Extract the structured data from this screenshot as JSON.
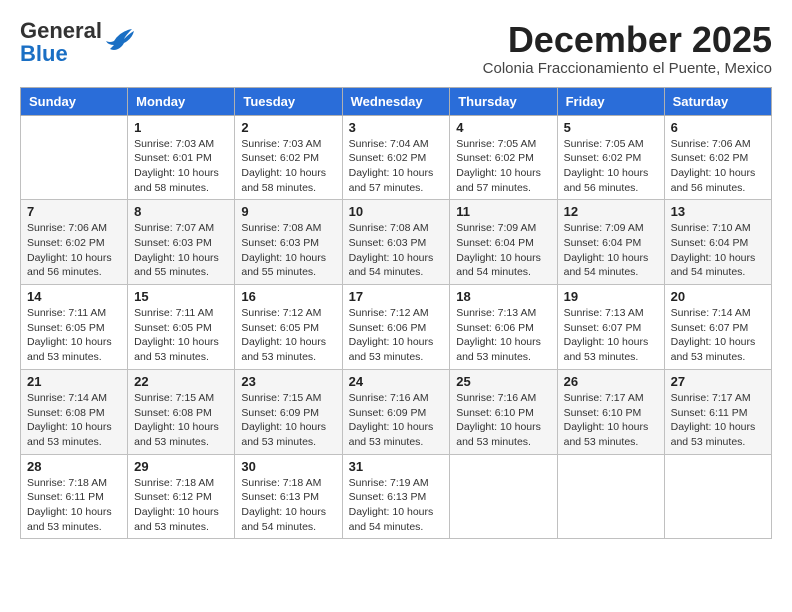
{
  "header": {
    "logo_general": "General",
    "logo_blue": "Blue",
    "month_title": "December 2025",
    "subtitle": "Colonia Fraccionamiento el Puente, Mexico"
  },
  "days_of_week": [
    "Sunday",
    "Monday",
    "Tuesday",
    "Wednesday",
    "Thursday",
    "Friday",
    "Saturday"
  ],
  "weeks": [
    [
      {
        "day": "",
        "info": ""
      },
      {
        "day": "1",
        "info": "Sunrise: 7:03 AM\nSunset: 6:01 PM\nDaylight: 10 hours and 58 minutes."
      },
      {
        "day": "2",
        "info": "Sunrise: 7:03 AM\nSunset: 6:02 PM\nDaylight: 10 hours and 58 minutes."
      },
      {
        "day": "3",
        "info": "Sunrise: 7:04 AM\nSunset: 6:02 PM\nDaylight: 10 hours and 57 minutes."
      },
      {
        "day": "4",
        "info": "Sunrise: 7:05 AM\nSunset: 6:02 PM\nDaylight: 10 hours and 57 minutes."
      },
      {
        "day": "5",
        "info": "Sunrise: 7:05 AM\nSunset: 6:02 PM\nDaylight: 10 hours and 56 minutes."
      },
      {
        "day": "6",
        "info": "Sunrise: 7:06 AM\nSunset: 6:02 PM\nDaylight: 10 hours and 56 minutes."
      }
    ],
    [
      {
        "day": "7",
        "info": "Sunrise: 7:06 AM\nSunset: 6:02 PM\nDaylight: 10 hours and 56 minutes."
      },
      {
        "day": "8",
        "info": "Sunrise: 7:07 AM\nSunset: 6:03 PM\nDaylight: 10 hours and 55 minutes."
      },
      {
        "day": "9",
        "info": "Sunrise: 7:08 AM\nSunset: 6:03 PM\nDaylight: 10 hours and 55 minutes."
      },
      {
        "day": "10",
        "info": "Sunrise: 7:08 AM\nSunset: 6:03 PM\nDaylight: 10 hours and 54 minutes."
      },
      {
        "day": "11",
        "info": "Sunrise: 7:09 AM\nSunset: 6:04 PM\nDaylight: 10 hours and 54 minutes."
      },
      {
        "day": "12",
        "info": "Sunrise: 7:09 AM\nSunset: 6:04 PM\nDaylight: 10 hours and 54 minutes."
      },
      {
        "day": "13",
        "info": "Sunrise: 7:10 AM\nSunset: 6:04 PM\nDaylight: 10 hours and 54 minutes."
      }
    ],
    [
      {
        "day": "14",
        "info": "Sunrise: 7:11 AM\nSunset: 6:05 PM\nDaylight: 10 hours and 53 minutes."
      },
      {
        "day": "15",
        "info": "Sunrise: 7:11 AM\nSunset: 6:05 PM\nDaylight: 10 hours and 53 minutes."
      },
      {
        "day": "16",
        "info": "Sunrise: 7:12 AM\nSunset: 6:05 PM\nDaylight: 10 hours and 53 minutes."
      },
      {
        "day": "17",
        "info": "Sunrise: 7:12 AM\nSunset: 6:06 PM\nDaylight: 10 hours and 53 minutes."
      },
      {
        "day": "18",
        "info": "Sunrise: 7:13 AM\nSunset: 6:06 PM\nDaylight: 10 hours and 53 minutes."
      },
      {
        "day": "19",
        "info": "Sunrise: 7:13 AM\nSunset: 6:07 PM\nDaylight: 10 hours and 53 minutes."
      },
      {
        "day": "20",
        "info": "Sunrise: 7:14 AM\nSunset: 6:07 PM\nDaylight: 10 hours and 53 minutes."
      }
    ],
    [
      {
        "day": "21",
        "info": "Sunrise: 7:14 AM\nSunset: 6:08 PM\nDaylight: 10 hours and 53 minutes."
      },
      {
        "day": "22",
        "info": "Sunrise: 7:15 AM\nSunset: 6:08 PM\nDaylight: 10 hours and 53 minutes."
      },
      {
        "day": "23",
        "info": "Sunrise: 7:15 AM\nSunset: 6:09 PM\nDaylight: 10 hours and 53 minutes."
      },
      {
        "day": "24",
        "info": "Sunrise: 7:16 AM\nSunset: 6:09 PM\nDaylight: 10 hours and 53 minutes."
      },
      {
        "day": "25",
        "info": "Sunrise: 7:16 AM\nSunset: 6:10 PM\nDaylight: 10 hours and 53 minutes."
      },
      {
        "day": "26",
        "info": "Sunrise: 7:17 AM\nSunset: 6:10 PM\nDaylight: 10 hours and 53 minutes."
      },
      {
        "day": "27",
        "info": "Sunrise: 7:17 AM\nSunset: 6:11 PM\nDaylight: 10 hours and 53 minutes."
      }
    ],
    [
      {
        "day": "28",
        "info": "Sunrise: 7:18 AM\nSunset: 6:11 PM\nDaylight: 10 hours and 53 minutes."
      },
      {
        "day": "29",
        "info": "Sunrise: 7:18 AM\nSunset: 6:12 PM\nDaylight: 10 hours and 53 minutes."
      },
      {
        "day": "30",
        "info": "Sunrise: 7:18 AM\nSunset: 6:13 PM\nDaylight: 10 hours and 54 minutes."
      },
      {
        "day": "31",
        "info": "Sunrise: 7:19 AM\nSunset: 6:13 PM\nDaylight: 10 hours and 54 minutes."
      },
      {
        "day": "",
        "info": ""
      },
      {
        "day": "",
        "info": ""
      },
      {
        "day": "",
        "info": ""
      }
    ]
  ]
}
